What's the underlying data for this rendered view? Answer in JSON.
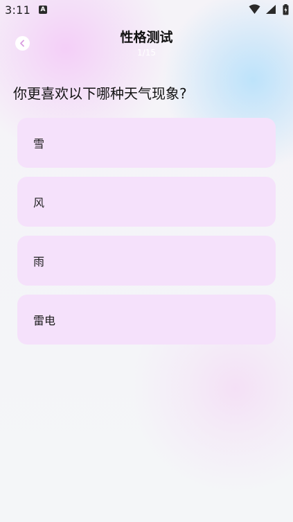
{
  "status_bar": {
    "time": "3:11",
    "notification_badge": "A",
    "icons": [
      "wifi-icon",
      "signal-icon",
      "battery-icon"
    ]
  },
  "header": {
    "title": "性格测试",
    "progress": "1/15",
    "back_icon": "chevron-left-icon"
  },
  "question": {
    "text": "你更喜欢以下哪种天气现象?"
  },
  "options": [
    {
      "label": "雪"
    },
    {
      "label": "风"
    },
    {
      "label": "雨"
    },
    {
      "label": "雷电"
    }
  ],
  "colors": {
    "option_bg": "#f5e1fb",
    "accent_pink": "#f4cdf8",
    "accent_blue": "#bae2fa"
  }
}
